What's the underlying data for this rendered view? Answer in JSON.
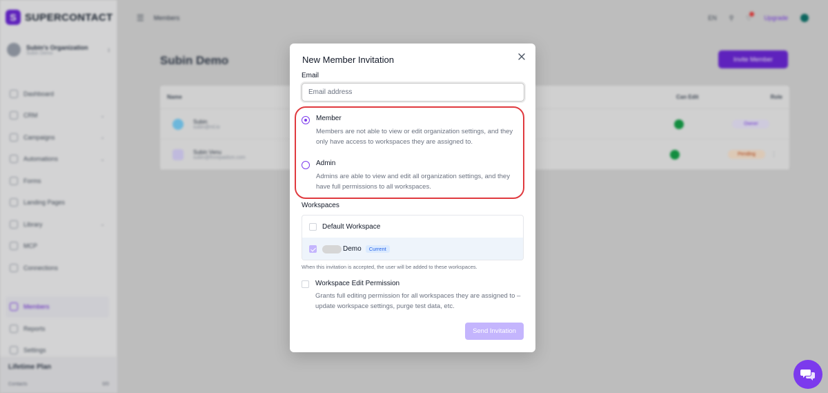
{
  "app": {
    "brand": "SUPERCONTACT",
    "org_name": "Subin's Organization",
    "org_sub": "Subin Demo",
    "breadcrumb": "Members",
    "language": "EN",
    "upgrade_label": "Upgrade",
    "accent_color": "#7c3aed"
  },
  "sidebar": {
    "items": [
      {
        "label": "Dashboard"
      },
      {
        "label": "CRM"
      },
      {
        "label": "Campaigns"
      },
      {
        "label": "Automations"
      },
      {
        "label": "Forms"
      },
      {
        "label": "Landing Pages"
      },
      {
        "label": "Library"
      },
      {
        "label": "MCP"
      },
      {
        "label": "Connections"
      }
    ],
    "bottom_items": [
      {
        "label": "Members"
      },
      {
        "label": "Reports"
      },
      {
        "label": "Settings"
      }
    ],
    "plan_title": "Lifetime Plan",
    "plan_label": "Contacts",
    "plan_value": "0/0"
  },
  "page": {
    "title": "Subin Demo",
    "invite_button": "Invite Member",
    "table_headers": {
      "name": "Name",
      "can_edit": "Can Edit",
      "role": "Role"
    },
    "rows": [
      {
        "name": "Subin",
        "email": "subin@ml.io",
        "role": "Owner"
      },
      {
        "name": "Subin Venu",
        "email": "subin@fmrepaidsm.com",
        "role": "Pending"
      }
    ]
  },
  "modal": {
    "title": "New Member Invitation",
    "email_label": "Email",
    "email_placeholder": "Email address",
    "email_value": "",
    "roles": [
      {
        "name": "Member",
        "description": "Members are not able to view or edit organization settings, and they only have access to workspaces they are assigned to.",
        "selected": true
      },
      {
        "name": "Admin",
        "description": "Admins are able to view and edit all organization settings, and they have full permissions to all workspaces.",
        "selected": false
      }
    ],
    "workspaces_label": "Workspaces",
    "workspaces": [
      {
        "name": "Default Workspace",
        "checked": false
      },
      {
        "name": "Demo",
        "checked": true,
        "badge": "Current"
      }
    ],
    "workspaces_help": "When this invitation is accepted, the user will be added to these workspaces.",
    "permission_name": "Workspace Edit Permission",
    "permission_description": "Grants full editing permission for all workspaces they are assigned to – update workspace settings, purge test data, etc.",
    "permission_checked": false,
    "send_button": "Send Invitation"
  }
}
